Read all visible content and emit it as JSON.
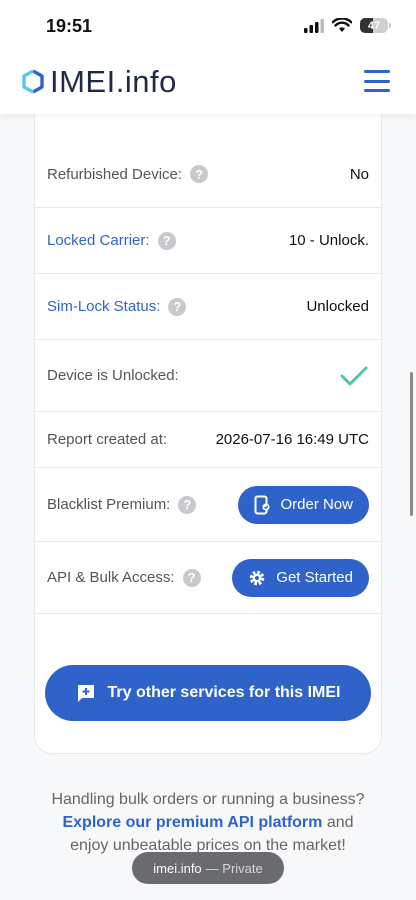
{
  "status_bar": {
    "time": "19:51",
    "battery": "47"
  },
  "header": {
    "logo_text": "IMEI.info"
  },
  "rows": [
    {
      "label": "Refurbished Device:",
      "value": "No"
    },
    {
      "label": "Locked Carrier:",
      "value": "10 - Unlock."
    },
    {
      "label": "Sim-Lock Status:",
      "value": "Unlocked"
    },
    {
      "label": "Device is Unlocked:"
    },
    {
      "label": "Report created at:",
      "value": "2026-07-16 16:49 UTC"
    },
    {
      "label": "Blacklist Premium:",
      "button": "Order Now"
    },
    {
      "label": "API & Bulk Access:",
      "button": "Get Started"
    }
  ],
  "cta": {
    "label": "Try other services for this IMEI"
  },
  "promo": {
    "line1": "Handling bulk orders or running a business?",
    "link": "Explore our premium API platform",
    "line2_tail": " and",
    "line3": "enjoy unbeatable prices on the market!"
  },
  "private_pill": {
    "site": "imei.info",
    "mode": "— Private"
  },
  "colors": {
    "accent": "#2f63c9",
    "check": "#4fc6a6"
  }
}
